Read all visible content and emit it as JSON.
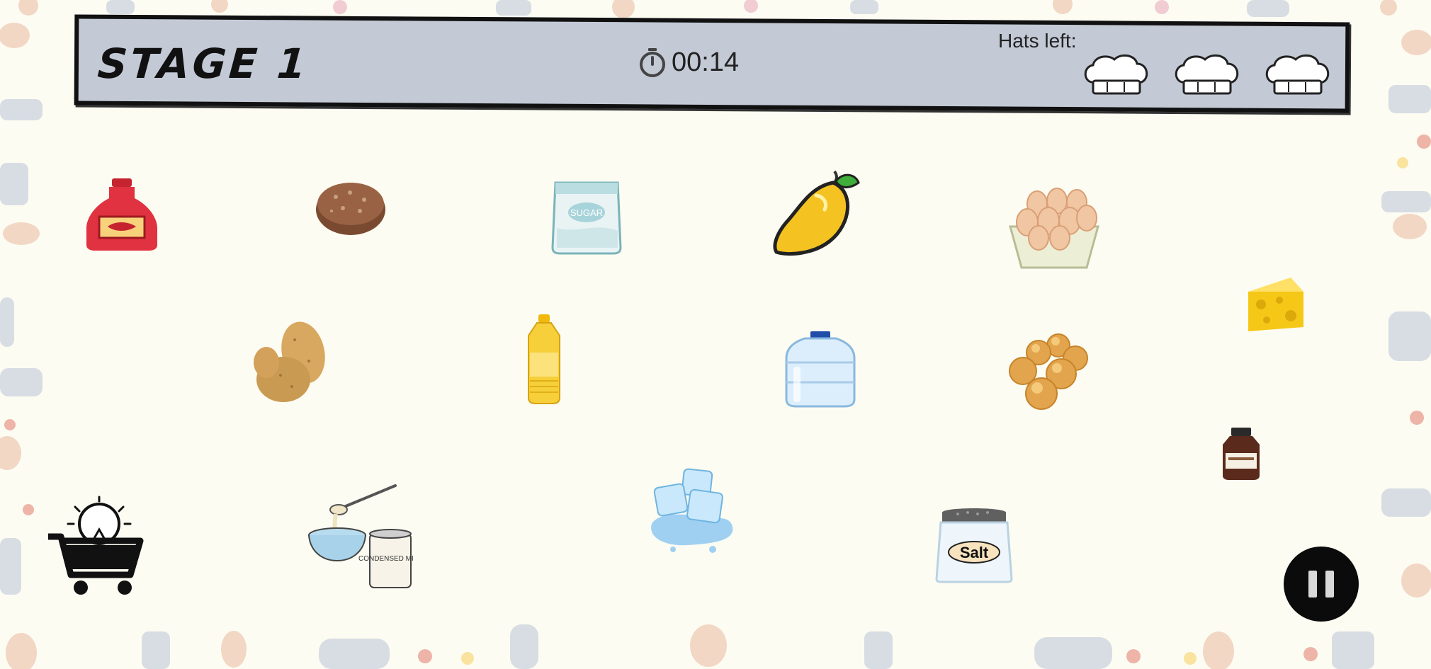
{
  "header": {
    "stage_title": "STAGE 1",
    "timer": "00:14",
    "hats_label": "Hats left:",
    "hats_remaining": 3
  },
  "items": [
    {
      "name": "ketchup"
    },
    {
      "name": "burger-patty"
    },
    {
      "name": "sugar"
    },
    {
      "name": "mango"
    },
    {
      "name": "eggs"
    },
    {
      "name": "cheese"
    },
    {
      "name": "potatoes"
    },
    {
      "name": "cooking-oil"
    },
    {
      "name": "water-bottle"
    },
    {
      "name": "bread-rolls"
    },
    {
      "name": "vanilla-extract"
    },
    {
      "name": "condensed-milk"
    },
    {
      "name": "ice-cubes"
    },
    {
      "name": "salt"
    }
  ],
  "salt_label": "Salt",
  "sugar_label": "SUGAR",
  "condensed_milk_label": "CONDENSED MILK",
  "colors": {
    "background": "#fdfcf2",
    "header_bg": "#c3cad6",
    "pause_button": "#0b0b0b"
  }
}
